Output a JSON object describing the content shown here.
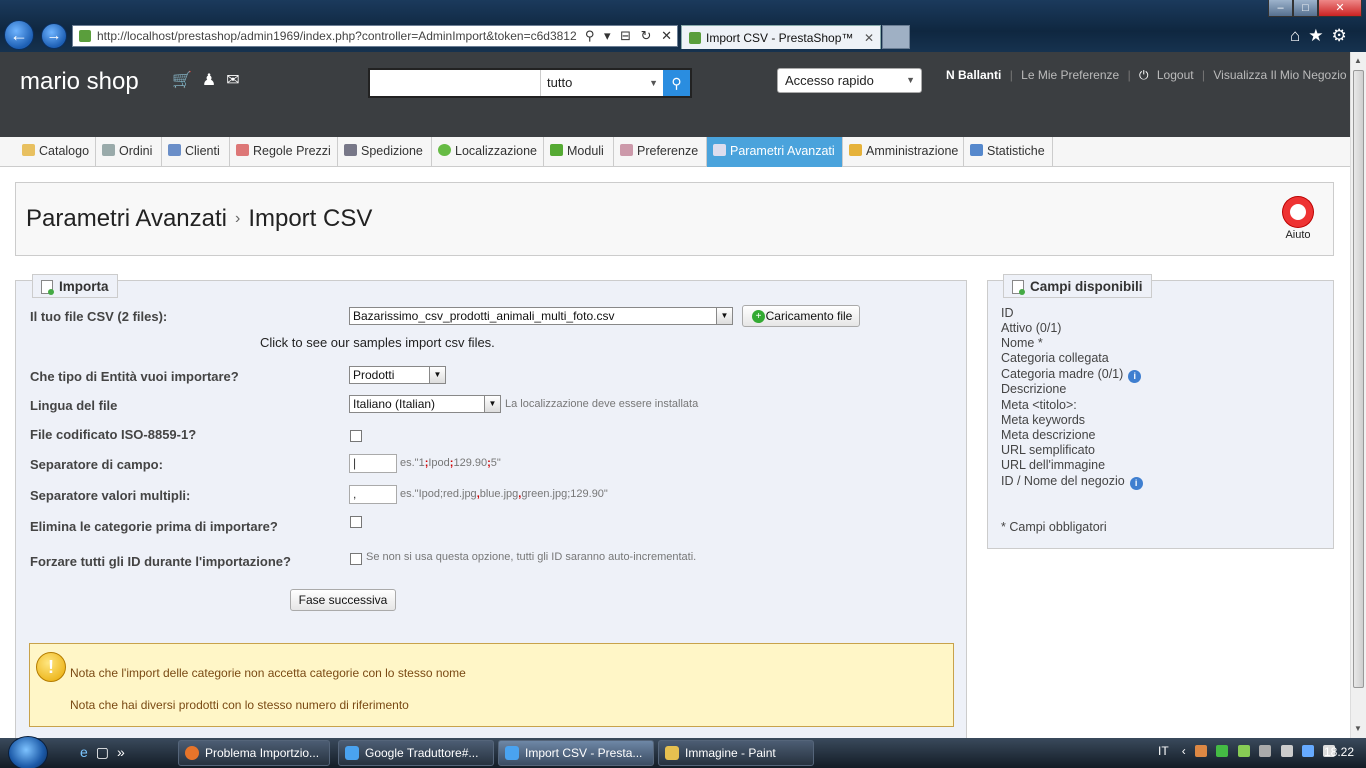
{
  "browser": {
    "url": "http://localhost/prestashop/admin1969/index.php?controller=AdminImport&token=c6d3812",
    "tab_title": "Import CSV - PrestaShop™",
    "addr_tools": "⚲ ▾ ⊟ ↻ ✕"
  },
  "header": {
    "shop_name": "mario shop",
    "search_value": "",
    "search_scope": "tutto",
    "quick_access": "Accesso rapido",
    "user_name": "N Ballanti",
    "preferences": "Le Mie Preferenze",
    "logout": "Logout",
    "view_shop": "Visualizza Il Mio Negozio"
  },
  "menu": {
    "items": [
      {
        "label": "Catalogo"
      },
      {
        "label": "Ordini"
      },
      {
        "label": "Clienti"
      },
      {
        "label": "Regole Prezzi"
      },
      {
        "label": "Spedizione"
      },
      {
        "label": "Localizzazione"
      },
      {
        "label": "Moduli"
      },
      {
        "label": "Preferenze"
      },
      {
        "label": "Parametri Avanzati"
      },
      {
        "label": "Amministrazione"
      },
      {
        "label": "Statistiche"
      }
    ],
    "active_index": 8
  },
  "page": {
    "breadcrumb_parent": "Parametri Avanzati",
    "breadcrumb_current": "Import CSV",
    "help_label": "Aiuto"
  },
  "import": {
    "legend": "Importa",
    "csv_file_label": "Il tuo file CSV (2 files):",
    "csv_file_value": "Bazarissimo_csv_prodotti_animali_multi_foto.csv",
    "upload_button": "Caricamento file",
    "samples_link": "Click to see our samples import csv files.",
    "entity_label": "Che tipo di Entità vuoi importare?",
    "entity_value": "Prodotti",
    "language_label": "Lingua del file",
    "language_value": "Italiano (Italian)",
    "language_hint": "La localizzazione deve essere installata",
    "iso_label": "File codificato ISO-8859-1?",
    "field_sep_label": "Separatore di campo:",
    "field_sep_value": "",
    "field_sep_hint": {
      "pre": "es.\"1",
      "s1": ";",
      "a": "Ipod",
      "s2": ";",
      "b": "129.90",
      "s3": ";",
      "c": "5\""
    },
    "multi_sep_label": "Separatore valori multipli:",
    "multi_sep_value": ",",
    "multi_sep_hint": {
      "pre": "es.\"Ipod;red.jpg",
      "s1": ",",
      "a": "blue.jpg",
      "s2": ",",
      "b": "green.jpg;129.90\""
    },
    "delete_cats_label": "Elimina le categorie prima di importare?",
    "force_ids_label": "Forzare tutti gli ID durante l'importazione?",
    "force_ids_hint": "Se non si usa questa opzione, tutti gli ID saranno auto-incrementati.",
    "next_button": "Fase successiva",
    "warning_1": "Nota che l'import delle categorie non accetta categorie con lo stesso nome",
    "warning_2": "Nota che hai diversi prodotti con lo stesso numero di riferimento"
  },
  "fields": {
    "legend": "Campi disponibili",
    "items": [
      {
        "label": "ID"
      },
      {
        "label": "Attivo (0/1)"
      },
      {
        "label": "Nome *"
      },
      {
        "label": "Categoria collegata"
      },
      {
        "label": "Categoria madre (0/1)",
        "info": true
      },
      {
        "label": "Descrizione"
      },
      {
        "label": "Meta <titolo>:"
      },
      {
        "label": "Meta keywords"
      },
      {
        "label": "Meta descrizione"
      },
      {
        "label": "URL semplificato"
      },
      {
        "label": "URL dell'immagine"
      },
      {
        "label": "ID / Nome del negozio",
        "info": true
      }
    ],
    "required_note": "* Campi obbligatori"
  },
  "taskbar": {
    "items": [
      {
        "label": "Problema Importzio..."
      },
      {
        "label": "Google Traduttore#..."
      },
      {
        "label": "Import CSV - Presta..."
      },
      {
        "label": "Immagine - Paint"
      }
    ],
    "language": "IT",
    "clock": "18.22"
  },
  "colors": {
    "accent": "#4aa3dc",
    "header_bg": "#3b3e41",
    "warning_bg": "#fff6c7"
  }
}
